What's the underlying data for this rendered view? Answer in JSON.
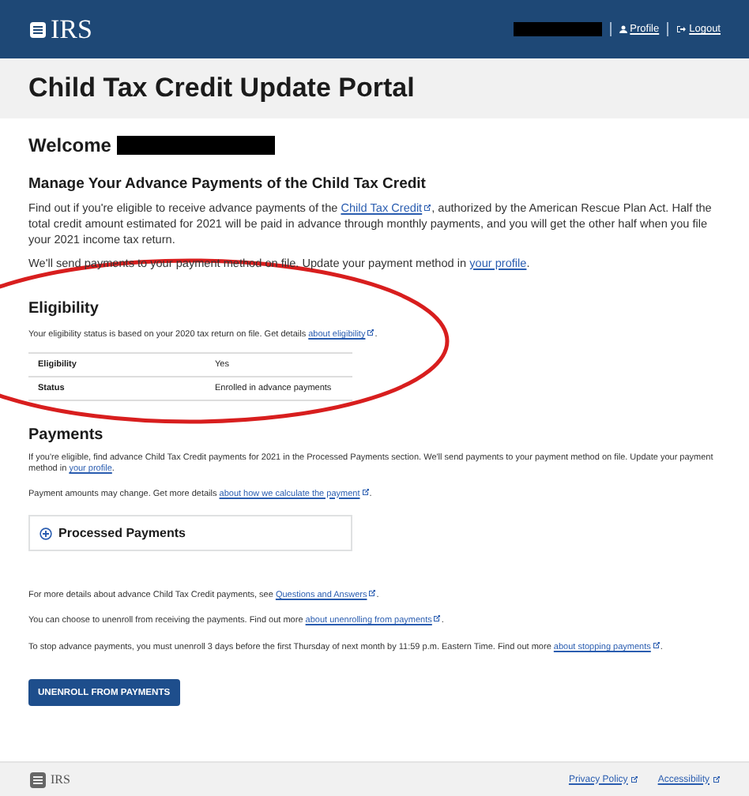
{
  "header": {
    "logo": "IRS",
    "links": [
      {
        "label": "Profile"
      },
      {
        "label": "Logout"
      }
    ]
  },
  "title_band": {
    "title": "Child Tax Credit Update Portal"
  },
  "welcome": {
    "label": "Welcome"
  },
  "intro": {
    "heading": "Manage Your Advance Payments of the Child Tax Credit",
    "paragraphs": [
      [
        {
          "kind": "text",
          "text": "Find out if you're eligible to receive advance payments of the "
        },
        {
          "kind": "ext_link",
          "text": "Child Tax Credit"
        },
        {
          "kind": "text",
          "text": ", authorized by the American Rescue Plan Act. Half the total credit amount estimated for 2021 will be paid in advance through monthly payments, and you will get the other half when you file your 2021 income tax return."
        }
      ],
      [
        {
          "kind": "text",
          "text": "We'll send payments to your payment method on file. Update your payment method in "
        },
        {
          "kind": "link",
          "text": "your profile"
        },
        {
          "kind": "text",
          "text": "."
        }
      ]
    ]
  },
  "eligibility": {
    "heading": "Eligibility",
    "paragraphs": [
      [
        {
          "kind": "text",
          "text": "Your eligibility status is based on your 2020 tax return on file. Get details "
        },
        {
          "kind": "ext_link",
          "text": "about eligibility"
        },
        {
          "kind": "text",
          "text": "."
        }
      ]
    ],
    "table": {
      "rows": [
        {
          "label": "Eligibility",
          "value": "Yes"
        },
        {
          "label": "Status",
          "value": "Enrolled in advance payments"
        }
      ]
    }
  },
  "payments": {
    "heading": "Payments",
    "paragraphs": [
      [
        {
          "kind": "text",
          "text": "If you're eligible, find advance Child Tax Credit payments for 2021 in the Processed Payments section. We'll send payments to your payment method on file. Update your payment method in "
        },
        {
          "kind": "link",
          "text": "your profile"
        },
        {
          "kind": "text",
          "text": "."
        }
      ],
      [
        {
          "kind": "text",
          "text": "Payment amounts may change. Get more details "
        },
        {
          "kind": "ext_link",
          "text": "about how we calculate the payment"
        },
        {
          "kind": "text",
          "text": "."
        }
      ]
    ],
    "accordion": {
      "label": "Processed Payments",
      "expanded": false
    },
    "more": [
      [
        {
          "kind": "text",
          "text": "For more details about advance Child Tax Credit payments, see "
        },
        {
          "kind": "ext_link",
          "text": "Questions and Answers"
        },
        {
          "kind": "text",
          "text": "."
        }
      ],
      [
        {
          "kind": "text",
          "text": "You can choose to unenroll from receiving the payments. Find out more "
        },
        {
          "kind": "ext_link",
          "text": "about unenrolling from payments"
        },
        {
          "kind": "text",
          "text": "."
        }
      ],
      [
        {
          "kind": "text",
          "text": "To stop advance payments, you must unenroll 3 days before the first Thursday of next month by 11:59 p.m. Eastern Time. Find out more "
        },
        {
          "kind": "ext_link",
          "text": "about stopping payments"
        },
        {
          "kind": "text",
          "text": "."
        }
      ]
    ],
    "button": "UNENROLL FROM PAYMENTS"
  },
  "footer": {
    "logo": "IRS",
    "links": [
      {
        "label": "Privacy Policy"
      },
      {
        "label": "Accessibility"
      }
    ]
  },
  "annotation": {
    "kind": "ellipse",
    "color": "#d81e1e"
  }
}
